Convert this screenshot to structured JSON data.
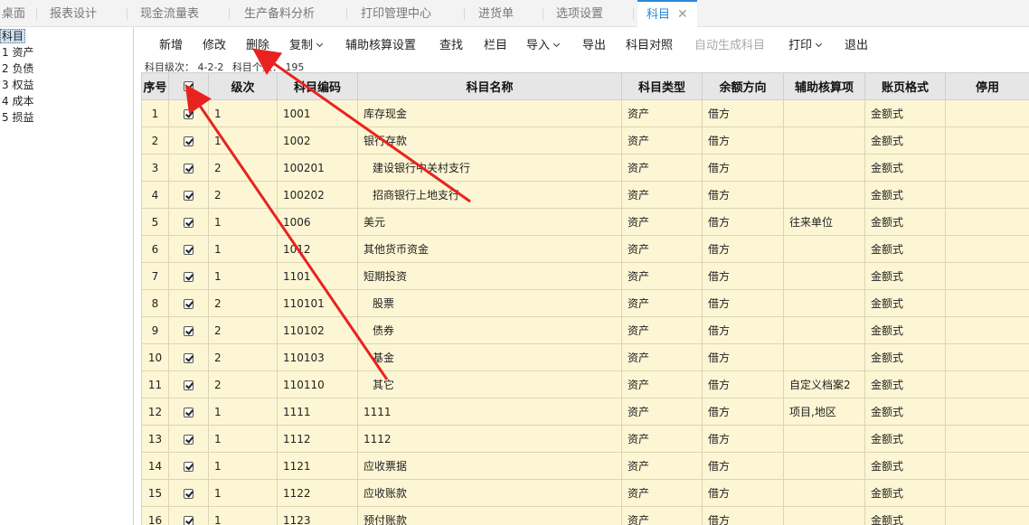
{
  "tabs": [
    "桌面",
    "报表设计",
    "现金流量表",
    "生产备料分析",
    "打印管理中心",
    "进货单",
    "选项设置",
    "科目"
  ],
  "tab_close_glyph": "✕",
  "tree": {
    "root": "科目",
    "items": [
      "1 资产",
      "2 负债",
      "3 权益",
      "4 成本",
      "5 损益"
    ]
  },
  "toolbar": {
    "add": "新增",
    "edit": "修改",
    "delete": "删除",
    "copy": "复制",
    "aux_settings": "辅助核算设置",
    "find": "查找",
    "columns": "栏目",
    "import": "导入",
    "export": "导出",
    "account_map": "科目对照",
    "auto_generate": "自动生成科目",
    "print": "打印",
    "exit": "退出"
  },
  "info": {
    "level_label": "科目级次：",
    "level_value": "4-2-2",
    "count_label": "科目个数：",
    "count_value": "195"
  },
  "columns": [
    "序号",
    "",
    "级次",
    "科目编码",
    "科目名称",
    "科目类型",
    "余额方向",
    "辅助核算项",
    "账页格式",
    "停用"
  ],
  "rows": [
    {
      "idx": "1",
      "level": "1",
      "code": "1001",
      "name": "库存现金",
      "type": "资产",
      "dir": "借方",
      "aux": "",
      "fmt": "金额式",
      "off": ""
    },
    {
      "idx": "2",
      "level": "1",
      "code": "1002",
      "name": "银行存款",
      "type": "资产",
      "dir": "借方",
      "aux": "",
      "fmt": "金额式",
      "off": ""
    },
    {
      "idx": "3",
      "level": "2",
      "code": "100201",
      "name": "建设银行中关村支行",
      "type": "资产",
      "dir": "借方",
      "aux": "",
      "fmt": "金额式",
      "off": ""
    },
    {
      "idx": "4",
      "level": "2",
      "code": "100202",
      "name": "招商银行上地支行",
      "type": "资产",
      "dir": "借方",
      "aux": "",
      "fmt": "金额式",
      "off": ""
    },
    {
      "idx": "5",
      "level": "1",
      "code": "1006",
      "name": "美元",
      "type": "资产",
      "dir": "借方",
      "aux": "往来单位",
      "fmt": "金额式",
      "off": ""
    },
    {
      "idx": "6",
      "level": "1",
      "code": "1012",
      "name": "其他货币资金",
      "type": "资产",
      "dir": "借方",
      "aux": "",
      "fmt": "金额式",
      "off": ""
    },
    {
      "idx": "7",
      "level": "1",
      "code": "1101",
      "name": "短期投资",
      "type": "资产",
      "dir": "借方",
      "aux": "",
      "fmt": "金额式",
      "off": ""
    },
    {
      "idx": "8",
      "level": "2",
      "code": "110101",
      "name": "股票",
      "type": "资产",
      "dir": "借方",
      "aux": "",
      "fmt": "金额式",
      "off": ""
    },
    {
      "idx": "9",
      "level": "2",
      "code": "110102",
      "name": "债券",
      "type": "资产",
      "dir": "借方",
      "aux": "",
      "fmt": "金额式",
      "off": ""
    },
    {
      "idx": "10",
      "level": "2",
      "code": "110103",
      "name": "基金",
      "type": "资产",
      "dir": "借方",
      "aux": "",
      "fmt": "金额式",
      "off": ""
    },
    {
      "idx": "11",
      "level": "2",
      "code": "110110",
      "name": "其它",
      "type": "资产",
      "dir": "借方",
      "aux": "自定义档案2",
      "fmt": "金额式",
      "off": ""
    },
    {
      "idx": "12",
      "level": "1",
      "code": "1111",
      "name": "1111",
      "type": "资产",
      "dir": "借方",
      "aux": "项目,地区",
      "fmt": "金额式",
      "off": ""
    },
    {
      "idx": "13",
      "level": "1",
      "code": "1112",
      "name": "1112",
      "type": "资产",
      "dir": "借方",
      "aux": "",
      "fmt": "金额式",
      "off": ""
    },
    {
      "idx": "14",
      "level": "1",
      "code": "1121",
      "name": "应收票据",
      "type": "资产",
      "dir": "借方",
      "aux": "",
      "fmt": "金额式",
      "off": ""
    },
    {
      "idx": "15",
      "level": "1",
      "code": "1122",
      "name": "应收账款",
      "type": "资产",
      "dir": "借方",
      "aux": "",
      "fmt": "金额式",
      "off": ""
    },
    {
      "idx": "16",
      "level": "1",
      "code": "1123",
      "name": "预付账款",
      "type": "资产",
      "dir": "借方",
      "aux": "",
      "fmt": "金额式",
      "off": ""
    }
  ],
  "colors": {
    "accent": "#2a87d8",
    "row_bg": "#fdf6d4",
    "arrow": "#e8231f"
  }
}
